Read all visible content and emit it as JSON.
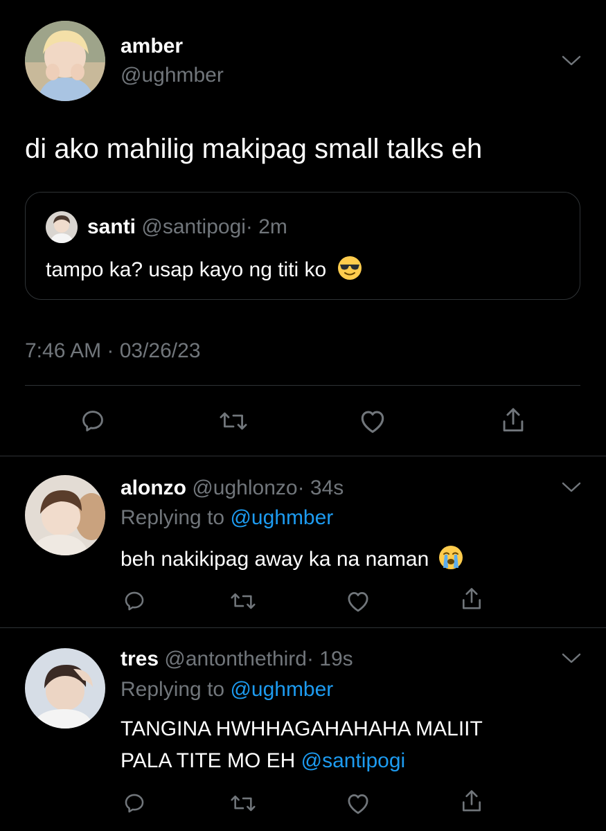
{
  "main_tweet": {
    "display_name": "amber",
    "handle": "@ughmber",
    "text": "di ako mahilig makipag small talks eh",
    "timestamp": "7:46 AM · 03/26/23",
    "quoted": {
      "display_name": "santi",
      "handle": "@santipogi",
      "time": "· 2m",
      "text": "tampo ka? usap kayo ng titi ko",
      "emoji": "smiling-face-with-sunglasses"
    }
  },
  "replies": [
    {
      "display_name": "alonzo",
      "handle": "@ughlonzo",
      "time": "· 34s",
      "replying_prefix": "Replying to",
      "replying_to": "@ughmber",
      "text": "beh nakikipag away ka na naman",
      "emoji": "loudly-crying-face"
    },
    {
      "display_name": "tres",
      "handle": "@antonthethird",
      "time": "· 19s",
      "replying_prefix": "Replying to",
      "replying_to": "@ughmber",
      "text_line1": "TANGINA HWHHAGAHAHAHA MALIIT",
      "text_line2": "PALA TITE MO EH",
      "mention": "@santipogi"
    }
  ],
  "icons": {
    "reply": "reply-icon",
    "retweet": "retweet-icon",
    "like": "like-icon",
    "share": "share-icon",
    "more": "chevron-down-icon"
  },
  "colors": {
    "background": "#000000",
    "text": "#ffffff",
    "secondary": "#71767b",
    "accent": "#1d9bf0",
    "divider": "#2f3336"
  }
}
